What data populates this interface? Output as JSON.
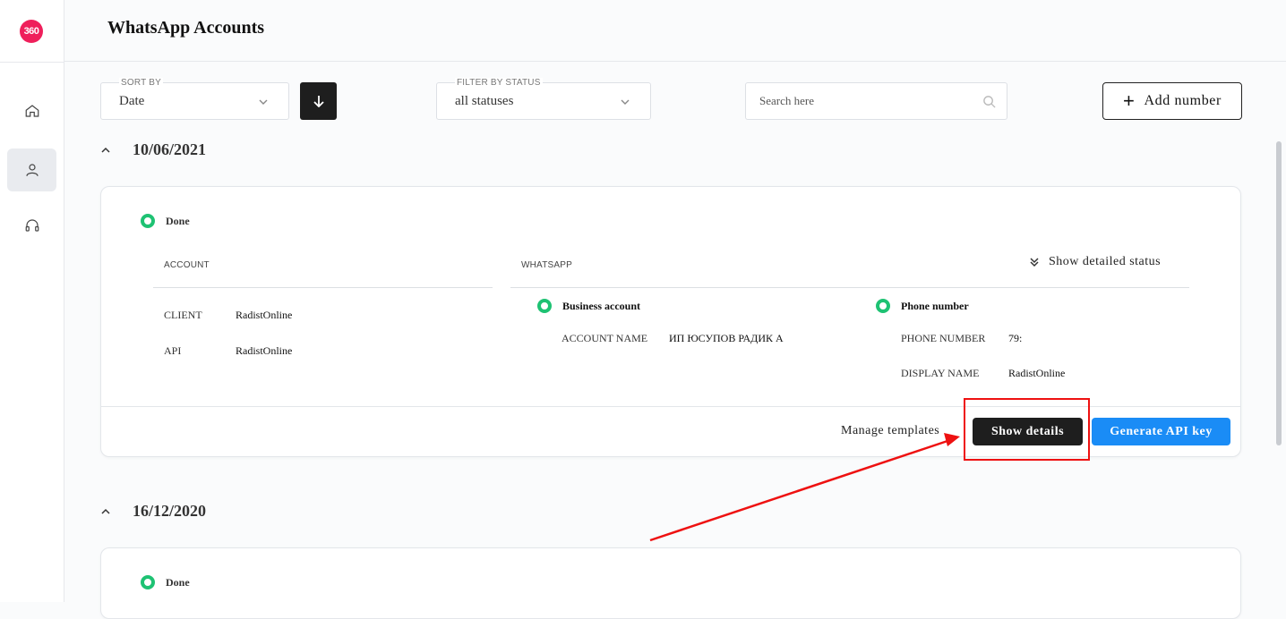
{
  "app": {
    "logo_text": "360",
    "brand_color": "#ef1f5b"
  },
  "sidebar": {
    "items": [
      {
        "name": "home",
        "icon": "home-icon",
        "active": false
      },
      {
        "name": "accounts",
        "icon": "user-icon",
        "active": true
      },
      {
        "name": "support",
        "icon": "headset-icon",
        "active": false
      }
    ]
  },
  "header": {
    "title": "WhatsApp Accounts"
  },
  "toolbar": {
    "sort_label": "SORT BY",
    "sort_value": "Date",
    "filter_label": "FILTER BY STATUS",
    "filter_value": "all statuses",
    "search_placeholder": "Search here",
    "add_label": "Add number"
  },
  "groups": [
    {
      "date": "10/06/2021",
      "card": {
        "status": "Done",
        "account_label": "ACCOUNT",
        "whatsapp_label": "WHATSAPP",
        "show_status_label": "Show detailed status",
        "client_key": "CLIENT",
        "client_val": "RadistOnline",
        "api_key": "API",
        "api_val": "RadistOnline",
        "business_title": "Business account",
        "account_name_key": "ACCOUNT NAME",
        "account_name_val": "ИП ЮСУПОВ РАДИК А",
        "phone_title": "Phone number",
        "phone_number_key": "PHONE NUMBER",
        "phone_number_val": "79:",
        "display_name_key": "DISPLAY NAME",
        "display_name_val": "RadistOnline",
        "manage_label": "Manage templates",
        "details_label": "Show details",
        "api_btn_label": "Generate API key"
      }
    },
    {
      "date": "16/12/2020",
      "card": {
        "status": "Done"
      }
    }
  ],
  "colors": {
    "status_done": "#1ec273",
    "primary_button": "#1a8cf6",
    "dark_button": "#1e1e1e",
    "annotation": "#ee1111"
  }
}
